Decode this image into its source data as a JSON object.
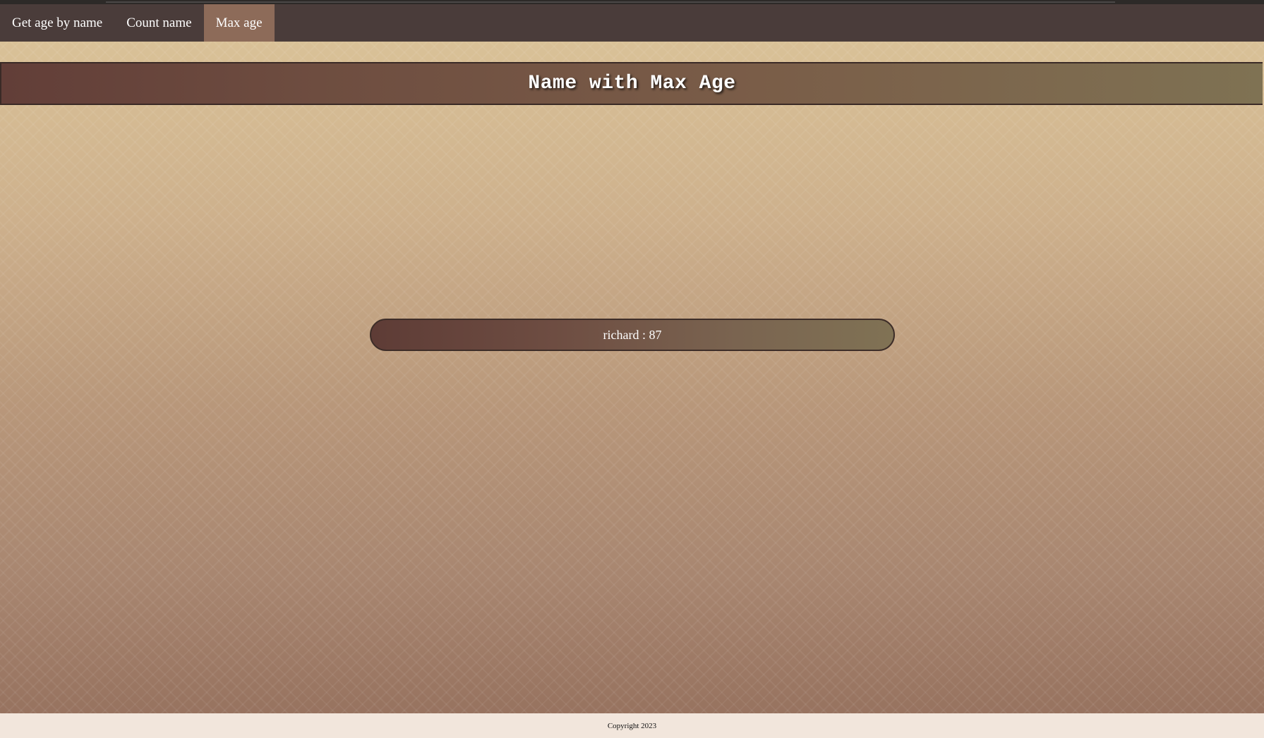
{
  "nav": {
    "items": [
      {
        "label": "Get age by name",
        "active": false
      },
      {
        "label": "Count name",
        "active": false
      },
      {
        "label": "Max age",
        "active": true
      }
    ]
  },
  "page": {
    "title": "Name with Max Age"
  },
  "result": {
    "text": "richard : 87"
  },
  "footer": {
    "text": "Copyright 2023"
  },
  "colors": {
    "navbar": "#4a3c3a",
    "nav_active": "#8d6b59",
    "footer_bg": "#f2e6dc"
  }
}
